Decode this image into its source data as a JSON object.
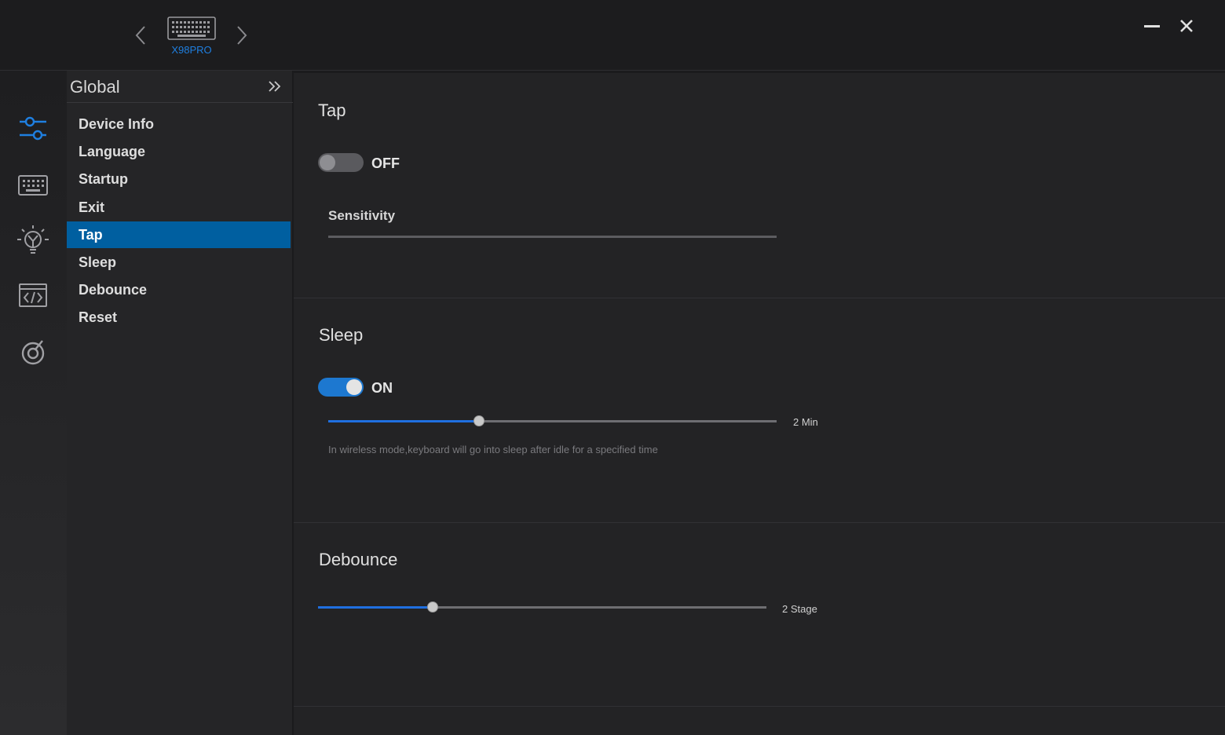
{
  "device": {
    "name": "X98PRO"
  },
  "menu": {
    "title": "Global",
    "items": [
      {
        "label": "Device Info"
      },
      {
        "label": "Language"
      },
      {
        "label": "Startup"
      },
      {
        "label": "Exit"
      },
      {
        "label": "Tap"
      },
      {
        "label": "Sleep"
      },
      {
        "label": "Debounce"
      },
      {
        "label": "Reset"
      }
    ],
    "active_index": 4
  },
  "sidebar_icons": [
    "settings-sliders-icon",
    "keyboard-icon",
    "lighting-icon",
    "macro-code-icon",
    "about-icon"
  ],
  "sections": {
    "tap": {
      "title": "Tap",
      "toggle_state": "OFF",
      "sensitivity_label": "Sensitivity"
    },
    "sleep": {
      "title": "Sleep",
      "toggle_state": "ON",
      "slider_fraction": 0.337,
      "value_text": "2 Min",
      "hint": "In wireless mode,keyboard will go into sleep after idle for a specified time"
    },
    "debounce": {
      "title": "Debounce",
      "slider_fraction": 0.255,
      "value_text": "2 Stage"
    }
  },
  "colors": {
    "accent": "#1f6fe0",
    "active_menu": "#005fa0",
    "device_name": "#1f7fe0"
  }
}
